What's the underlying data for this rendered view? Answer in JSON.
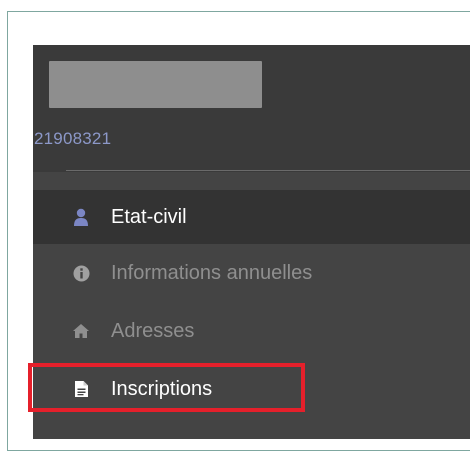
{
  "student": {
    "id": "21908321"
  },
  "menu": {
    "items": [
      {
        "label": "Etat-civil",
        "icon": "user-icon",
        "active": true
      },
      {
        "label": "Informations annuelles",
        "icon": "info-icon",
        "active": false
      },
      {
        "label": "Adresses",
        "icon": "home-icon",
        "active": false
      },
      {
        "label": "Inscriptions",
        "icon": "document-icon",
        "active": false,
        "highlighted": true
      }
    ]
  },
  "colors": {
    "sidebar_bg": "#444444",
    "active_bg": "#333333",
    "id_text": "#8c98c8",
    "user_icon": "#7b86c4",
    "highlight_border": "#e5202b"
  }
}
